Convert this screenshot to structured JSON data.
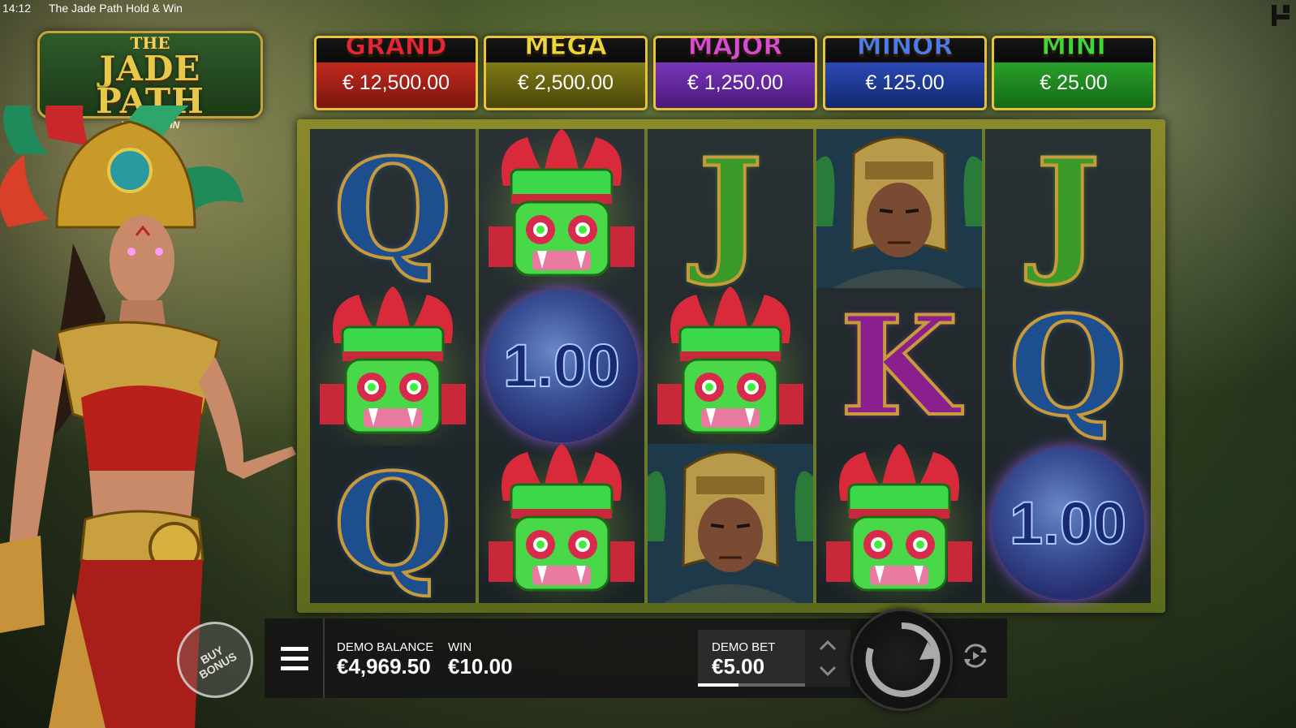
{
  "status_bar": {
    "time": "14:12",
    "title": "The Jade Path Hold & Win"
  },
  "logo": {
    "line1": "THE",
    "line2": "JADE PATH",
    "line3": "HOLD & WIN"
  },
  "jackpots": [
    {
      "label": "GRAND",
      "value": "€ 12,500.00",
      "label_color": "#e8233a",
      "value_bg": "#a02218"
    },
    {
      "label": "MEGA",
      "value": "€ 2,500.00",
      "label_color": "#e8d83a",
      "value_bg": "#6e6a12"
    },
    {
      "label": "MAJOR",
      "value": "€ 1,250.00",
      "label_color": "#d84ad8",
      "value_bg": "#6a2aa0"
    },
    {
      "label": "MINOR",
      "value": "€ 125.00",
      "label_color": "#4a7cf0",
      "value_bg": "#1e3c9a"
    },
    {
      "label": "MINI",
      "value": "€ 25.00",
      "label_color": "#3ad83a",
      "value_bg": "#1e8a22"
    }
  ],
  "reels": [
    [
      {
        "type": "letter",
        "symbol": "Q"
      },
      {
        "type": "mask"
      },
      {
        "type": "letter",
        "symbol": "Q"
      }
    ],
    [
      {
        "type": "mask"
      },
      {
        "type": "orb",
        "value": "1.00"
      },
      {
        "type": "mask"
      }
    ],
    [
      {
        "type": "letter",
        "symbol": "J"
      },
      {
        "type": "mask"
      },
      {
        "type": "warrior"
      }
    ],
    [
      {
        "type": "warrior"
      },
      {
        "type": "letter",
        "symbol": "K"
      },
      {
        "type": "mask"
      }
    ],
    [
      {
        "type": "letter",
        "symbol": "J"
      },
      {
        "type": "letter",
        "symbol": "Q"
      },
      {
        "type": "orb",
        "value": "1.00"
      }
    ]
  ],
  "controls": {
    "buy_bonus_line1": "BUY",
    "buy_bonus_line2": "BONUS",
    "balance_label": "DEMO BALANCE",
    "balance_value": "€4,969.50",
    "win_label": "WIN",
    "win_value": "€10.00",
    "bet_label": "DEMO BET",
    "bet_value": "€5.00",
    "bet_level_fraction": 0.38
  },
  "icons": {
    "menu": "hamburger-menu-icon",
    "spin": "spin-icon",
    "autoplay": "autoplay-icon",
    "bet_up": "chevron-up-icon",
    "bet_down": "chevron-down-icon"
  }
}
